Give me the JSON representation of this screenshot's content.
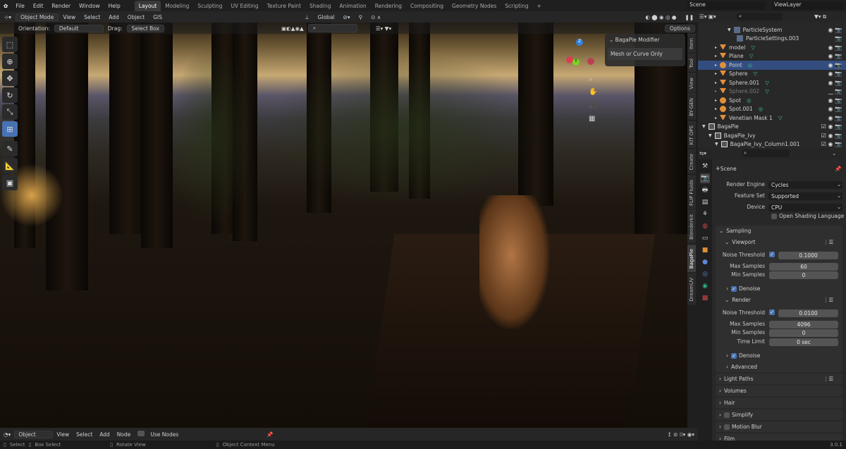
{
  "menu": [
    "File",
    "Edit",
    "Render",
    "Window",
    "Help"
  ],
  "workspaces": [
    "Layout",
    "Modeling",
    "Sculpting",
    "UV Editing",
    "Texture Paint",
    "Shading",
    "Animation",
    "Rendering",
    "Compositing",
    "Geometry Nodes",
    "Scripting",
    "+"
  ],
  "active_workspace": "Layout",
  "scene": "Scene",
  "view_layer": "ViewLayer",
  "viewport_header": {
    "mode": "Object Mode",
    "items": [
      "View",
      "Select",
      "Add",
      "Object",
      "GIS"
    ],
    "transform": "Global"
  },
  "tool_settings": {
    "orientation_label": "Orientation:",
    "orientation": "Default",
    "drag_label": "Drag:",
    "drag": "Select Box",
    "options": "Options"
  },
  "popup": {
    "title": "BagaPie Modifier",
    "button": "Mesh or Curve Only"
  },
  "sidebar_tabs": [
    "Item",
    "Tool",
    "View",
    "BY-GEN",
    "KIT OPS",
    "Create",
    "FLIP Fluids",
    "Blenderkit",
    "BagaPie",
    "DreamUV"
  ],
  "active_sidebar_tab": "BagaPie",
  "outliner": [
    {
      "name": "ParticleSystem",
      "indent": 4,
      "type": "particles"
    },
    {
      "name": "ParticleSettings.003",
      "indent": 5,
      "type": "settings"
    },
    {
      "name": "model",
      "indent": 2,
      "type": "mesh"
    },
    {
      "name": "Plane",
      "indent": 2,
      "type": "mesh"
    },
    {
      "name": "Point",
      "indent": 2,
      "type": "light",
      "selected": true
    },
    {
      "name": "Sphere",
      "indent": 2,
      "type": "mesh"
    },
    {
      "name": "Sphere.001",
      "indent": 2,
      "type": "mesh"
    },
    {
      "name": "Sphere.002",
      "indent": 2,
      "type": "mesh",
      "hidden": true
    },
    {
      "name": "Spot",
      "indent": 2,
      "type": "light"
    },
    {
      "name": "Spot.001",
      "indent": 2,
      "type": "light"
    },
    {
      "name": "Venetian Mask 1",
      "indent": 2,
      "type": "mesh"
    },
    {
      "name": "BagaPie",
      "indent": 0,
      "type": "collection"
    },
    {
      "name": "BagaPie_Ivy",
      "indent": 1,
      "type": "collection"
    },
    {
      "name": "BagaPie_Ivy_Column1.001",
      "indent": 2,
      "type": "collection"
    }
  ],
  "properties": {
    "context": "Scene",
    "render_engine_label": "Render Engine",
    "render_engine": "Cycles",
    "feature_set_label": "Feature Set",
    "feature_set": "Supported",
    "device_label": "Device",
    "device": "CPU",
    "osl": "Open Shading Language",
    "sampling": "Sampling",
    "viewport": {
      "title": "Viewport",
      "noise_label": "Noise Threshold",
      "noise": "0.1000",
      "max_label": "Max Samples",
      "max": "60",
      "min_label": "Min Samples",
      "min": "0",
      "denoise": "Denoise"
    },
    "render": {
      "title": "Render",
      "noise_label": "Noise Threshold",
      "noise": "0.0100",
      "max_label": "Max Samples",
      "max": "4096",
      "min_label": "Min Samples",
      "min": "0",
      "time_label": "Time Limit",
      "time": "0 sec",
      "denoise": "Denoise"
    },
    "advanced": "Advanced",
    "panels": [
      "Light Paths",
      "Volumes",
      "Hair",
      "Simplify",
      "Motion Blur",
      "Film"
    ]
  },
  "node_header": {
    "type": "Object",
    "items": [
      "View",
      "Select",
      "Add",
      "Node"
    ],
    "use_nodes": "Use Nodes"
  },
  "status": {
    "select": "Select",
    "box_select": "Box Select",
    "rotate": "Rotate View",
    "context": "Object Context Menu",
    "version": "3.0.1"
  }
}
